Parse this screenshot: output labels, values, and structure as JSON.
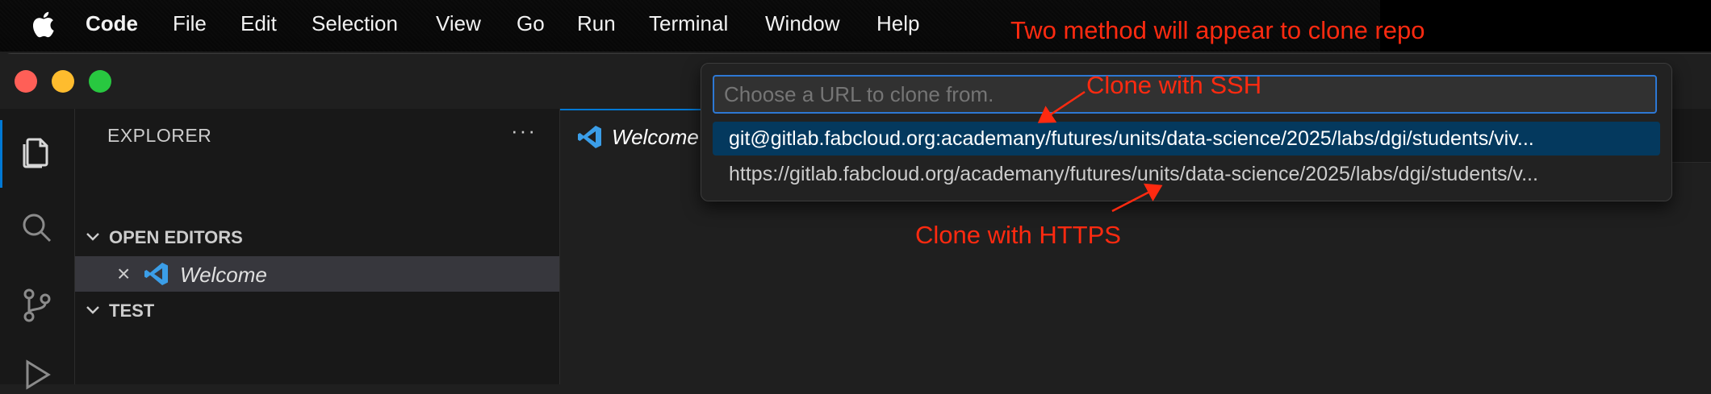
{
  "menubar": {
    "app_name": "Code",
    "items": [
      "File",
      "Edit",
      "Selection",
      "View",
      "Go",
      "Run",
      "Terminal",
      "Window",
      "Help"
    ]
  },
  "annotations": {
    "top": "Two method will appear to clone repo",
    "ssh": "Clone with SSH",
    "https": "Clone with HTTPS",
    "color": "#ff2a10"
  },
  "sidebar": {
    "title": "EXPLORER",
    "more": "···",
    "open_editors": "OPEN EDITORS",
    "editor_item": "Welcome",
    "test_section": "TEST"
  },
  "tabs": {
    "active": "Welcome"
  },
  "quickpick": {
    "placeholder": "Choose a URL to clone from.",
    "options": [
      "git@gitlab.fabcloud.org:academany/futures/units/data-science/2025/labs/dgi/students/viv...",
      "https://gitlab.fabcloud.org/academany/futures/units/data-science/2025/labs/dgi/students/v..."
    ]
  },
  "colors": {
    "accent": "#0078d4",
    "selection": "#04395e",
    "vscode_blue": "#3b9ee8"
  },
  "icons": [
    "apple-logo-icon",
    "explorer-icon",
    "search-icon",
    "source-control-icon",
    "run-debug-icon",
    "vscode-icon",
    "close-icon",
    "chevron-down-icon"
  ]
}
